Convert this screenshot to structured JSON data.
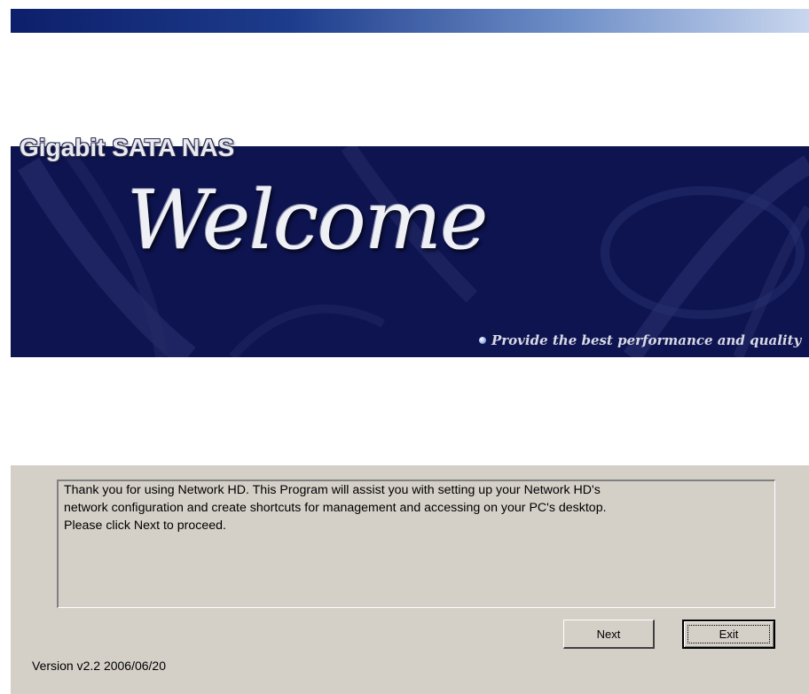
{
  "banner": {
    "product_name": "Gigabit SATA NAS",
    "welcome": "Welcome",
    "tagline": "Provide the best performance and quality"
  },
  "message": {
    "text": "Thank you for using Network HD. This Program will assist you with setting up your   Network HD's\nnetwork configuration and create shortcuts for management   and accessing on your PC's desktop.\nPlease click Next to proceed."
  },
  "buttons": {
    "next_label": "Next",
    "exit_label": "Exit"
  },
  "footer": {
    "version": "Version v2.2 2006/06/20"
  },
  "colors": {
    "title_gradient_start": "#0d1f6b",
    "banner_background": "#0e1450",
    "panel_background": "#d4d0c8"
  }
}
